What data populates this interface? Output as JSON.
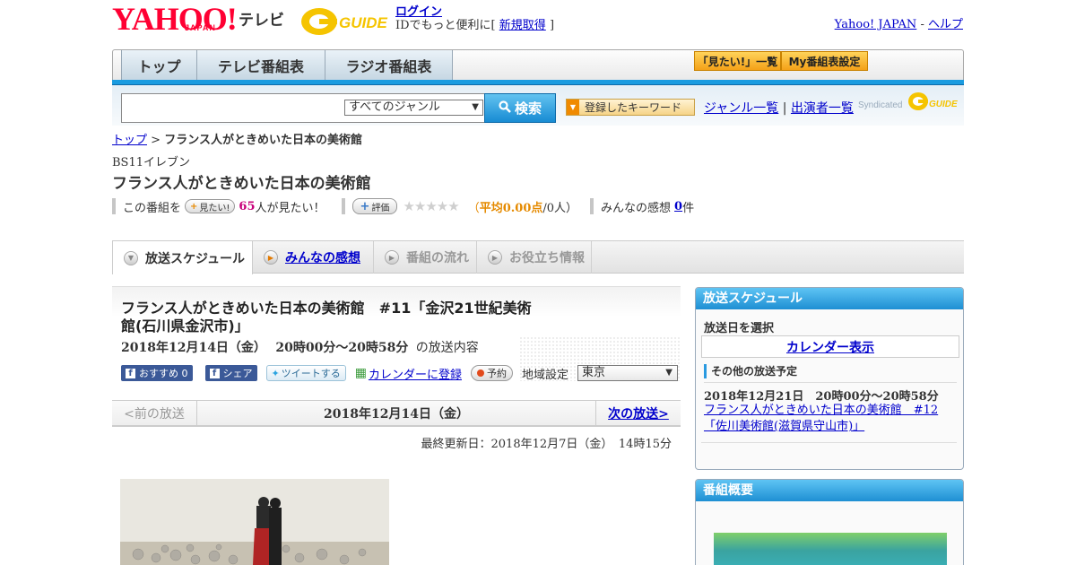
{
  "header": {
    "logo_text": "YAHOO!",
    "logo_sub": "JAPAN",
    "tv_label": "テレビ",
    "gguide_logo": "G GUIDE",
    "login_label": "ログイン",
    "id_text_prefix": "IDでもっと便利に[",
    "register_label": "新規取得",
    "id_text_suffix": "]",
    "yahoo_japan_link": "Yahoo! JAPAN",
    "separator": "-",
    "help_link": "ヘルプ"
  },
  "nav": {
    "tabs": [
      {
        "label": "トップ"
      },
      {
        "label": "テレビ番組表"
      },
      {
        "label": "ラジオ番組表"
      }
    ],
    "want_list_label": "「見たい!」一覧",
    "my_schedule_label": "My番組表設定"
  },
  "search": {
    "query": "",
    "genre_selected": "すべてのジャンル",
    "button_label": "検索",
    "keyword_label": "登録したキーワード",
    "genre_list_link": "ジャンル一覧",
    "divider": "|",
    "performer_list_link": "出演者一覧",
    "syndicated_label": "Syndicated"
  },
  "breadcrumb": {
    "home": "トップ",
    "sep": ">",
    "current": "フランス人がときめいた日本の美術館"
  },
  "program": {
    "channel": "BS11イレブン",
    "title": "フランス人がときめいた日本の美術館",
    "want_prefix": "この番組を",
    "want_button": "見たい!",
    "want_count": "65",
    "want_suffix": "人が見たい！",
    "rate_button": "評価",
    "stars": "★★★★★",
    "avg_open": "（",
    "avg_label": "平均0.00点",
    "avg_people": "/0人）",
    "impressions_label": "みんなの感想",
    "impressions_count": "0",
    "impressions_unit": "件"
  },
  "subtabs": [
    {
      "label": "放送スケジュール",
      "active": true
    },
    {
      "label": "みんなの感想",
      "active": false
    },
    {
      "label": "番組の流れ",
      "active": false
    },
    {
      "label": "お役立ち情報",
      "active": false
    }
  ],
  "episode": {
    "title": "フランス人がときめいた日本の美術館　#11「金沢21世紀美術館(石川県金沢市)」",
    "date": "2018年12月14日（金）",
    "time": "20時00分～20時58分",
    "date_suffix": "の放送内容",
    "fb_recommend": "おすすめ 0",
    "fb_share": "シェア",
    "tweet": "ツイートする",
    "calendar_link": "カレンダーに登録",
    "reserve": "予約",
    "region_label": "地域設定",
    "region_value": "東京",
    "prev_label": "<前の放送",
    "current_label": "2018年12月14日（金）",
    "next_label": "次の放送>",
    "last_updated": "最終更新日：2018年12月7日（金）　14時15分"
  },
  "sidebar": {
    "schedule_title": "放送スケジュール",
    "select_date": "放送日を選択",
    "calendar_button": "カレンダー表示",
    "other_title": "その他の放送予定",
    "other_date": "2018年12月21日　20時00分～20時58分",
    "other_link": "フランス人がときめいた日本の美術館　#12「佐川美術館(滋賀県守山市)」",
    "overview_title": "番組概要"
  },
  "colors": {
    "brand_red": "#ff0033",
    "accent_blue": "#1a9be0",
    "link_blue": "#0000cc",
    "orange": "#e58a00"
  }
}
